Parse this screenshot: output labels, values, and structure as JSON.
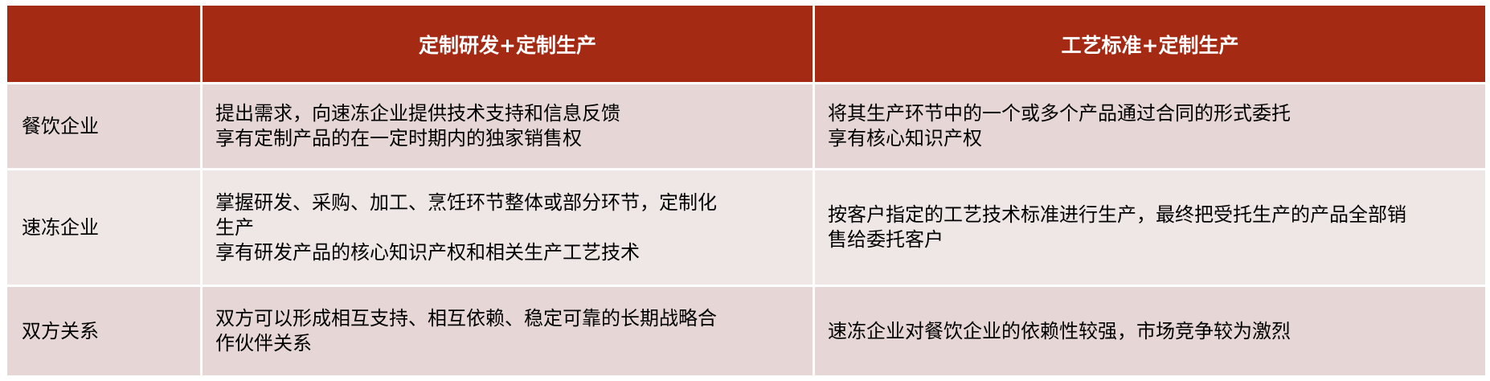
{
  "header": {
    "col1": "",
    "col2": "定制研发+定制生产",
    "col3": "工艺标准+定制生产"
  },
  "rows": [
    {
      "label": "餐饮企业",
      "col2": [
        "提出需求，向速冻企业提供技术支持和信息反馈",
        "享有定制产品的在一定时期内的独家销售权"
      ],
      "col3": [
        "将其生产环节中的一个或多个产品通过合同的形式委托",
        "享有核心知识产权"
      ]
    },
    {
      "label": "速冻企业",
      "col2": [
        "掌握研发、采购、加工、烹饪环节整体或部分环节，定制化",
        "生产",
        "享有研发产品的核心知识产权和相关生产工艺技术"
      ],
      "col3": [
        "按客户指定的工艺技术标准进行生产，最终把受托生产的产品全部销",
        "售给委托客户"
      ]
    },
    {
      "label": "双方关系",
      "col2": [
        "双方可以形成相互支持、相互依赖、稳定可靠的长期战略合",
        "作伙伴关系"
      ],
      "col3": [
        "速冻企业对餐饮企业的依赖性较强，市场竞争较为激烈"
      ]
    }
  ],
  "colors": {
    "header_bg": "#a52a14",
    "row_bg_odd": "#e6d6d6",
    "row_bg_even": "#efe6e6"
  }
}
